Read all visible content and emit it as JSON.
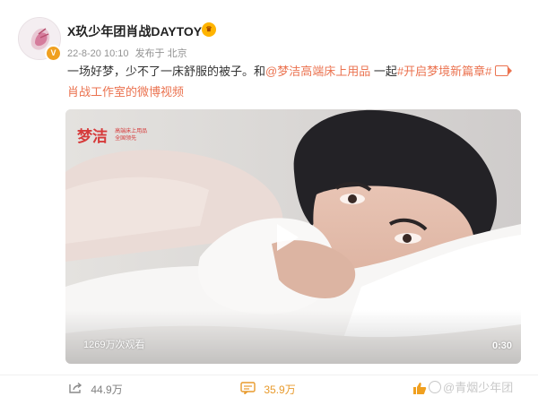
{
  "post": {
    "username": "X玖少年团肖战DAYTOY",
    "timestamp": "22-8-20 10:10",
    "source": "发布于 北京",
    "text": {
      "part1": "一场好梦，少不了一床舒服的被子。和",
      "mention": "@梦洁高端床上用品",
      "part2": " 一起",
      "hashtag": "#开启梦境新篇章#",
      "video_link": "肖战工作室的微博视频"
    }
  },
  "video": {
    "brand_main": "梦洁",
    "brand_sub_line1": "高端床上用品",
    "brand_sub_line2": "全国领先",
    "views": "1269万次观看",
    "duration": "0:30"
  },
  "actions": {
    "share_count": "44.9万",
    "comment_count": "35.9万",
    "like_count": "",
    "share_icon": "share-icon",
    "comment_icon": "comment-icon",
    "like_icon": "thumbs-up-icon"
  },
  "watermark": "@青烟少年团",
  "colors": {
    "link": "#eb7350",
    "comment_count": "#e89a2c",
    "verified_badge": "#f0a020"
  }
}
